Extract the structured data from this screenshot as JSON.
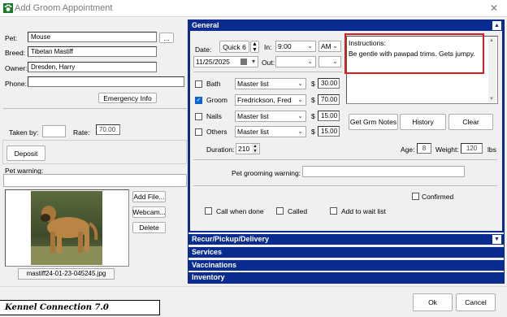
{
  "window": {
    "title": "Add Groom Appointment",
    "close": "✕"
  },
  "pet_info": {
    "pet_label": "Pet:",
    "pet_value": "Mouse",
    "pet_lookup": "...",
    "breed_label": "Breed:",
    "breed_value": "Tibetan Mastiff",
    "owner_label": "Owner:",
    "owner_value": "Dresden, Harry",
    "phone_label": "Phone:",
    "phone_value": "",
    "emergency_button": "Emergency Info",
    "taken_by_label": "Taken by:",
    "taken_by_value": "",
    "rate_label": "Rate:",
    "rate_value": "70.00",
    "deposit_button": "Deposit",
    "pet_warning_label": "Pet warning:",
    "pet_warning_value": "",
    "add_file_button": "Add File...",
    "webcam_button": "Webcam...",
    "delete_button": "Delete",
    "photo_filename": "mastiff24-01-23-045245.jpg"
  },
  "sections": {
    "general": "General",
    "recur": "Recur/Pickup/Delivery",
    "services": "Services",
    "vaccinations": "Vaccinations",
    "inventory": "Inventory"
  },
  "general": {
    "date_label": "Date:",
    "date_quick": "Quick 6",
    "date_value": "11/25/2025",
    "in_label": "In:",
    "in_time": "9:00",
    "in_ampm": "AM",
    "out_label": "Out:",
    "out_time": "",
    "out_ampm": "",
    "instructions_label": "Instructions:",
    "instructions_text": "Be gentle with pawpad trims. Gets jumpy.",
    "services": [
      {
        "name": "Bath",
        "checked": false,
        "provider": "Master list",
        "currency": "$",
        "price": "30.00"
      },
      {
        "name": "Groom",
        "checked": true,
        "provider": "Fredrickson, Fred",
        "currency": "$",
        "price": "70.00"
      },
      {
        "name": "Nails",
        "checked": false,
        "provider": "Master list",
        "currency": "$",
        "price": "15.00"
      },
      {
        "name": "Others",
        "checked": false,
        "provider": "Master list",
        "currency": "$",
        "price": "15.00"
      }
    ],
    "duration_label": "Duration:",
    "duration_value": "210",
    "get_grm_notes_button": "Get Grm Notes",
    "history_button": "History",
    "clear_button": "Clear",
    "age_label": "Age:",
    "age_value": "8",
    "weight_label": "Weight:",
    "weight_value": "120",
    "weight_unit": "lbs",
    "pet_grooming_warning_label": "Pet grooming warning:",
    "pet_grooming_warning_value": "",
    "confirmed_label": "Confirmed",
    "call_when_done_label": "Call when done",
    "called_label": "Called",
    "add_to_wait_list_label": "Add to wait list"
  },
  "footer": {
    "brand": "Kennel Connection 7.0",
    "ok_button": "Ok",
    "cancel_button": "Cancel"
  },
  "colors": {
    "section_bar": "#0a2b8f",
    "highlight_border": "#d81e1e",
    "checkbox_on": "#0a64d8"
  }
}
